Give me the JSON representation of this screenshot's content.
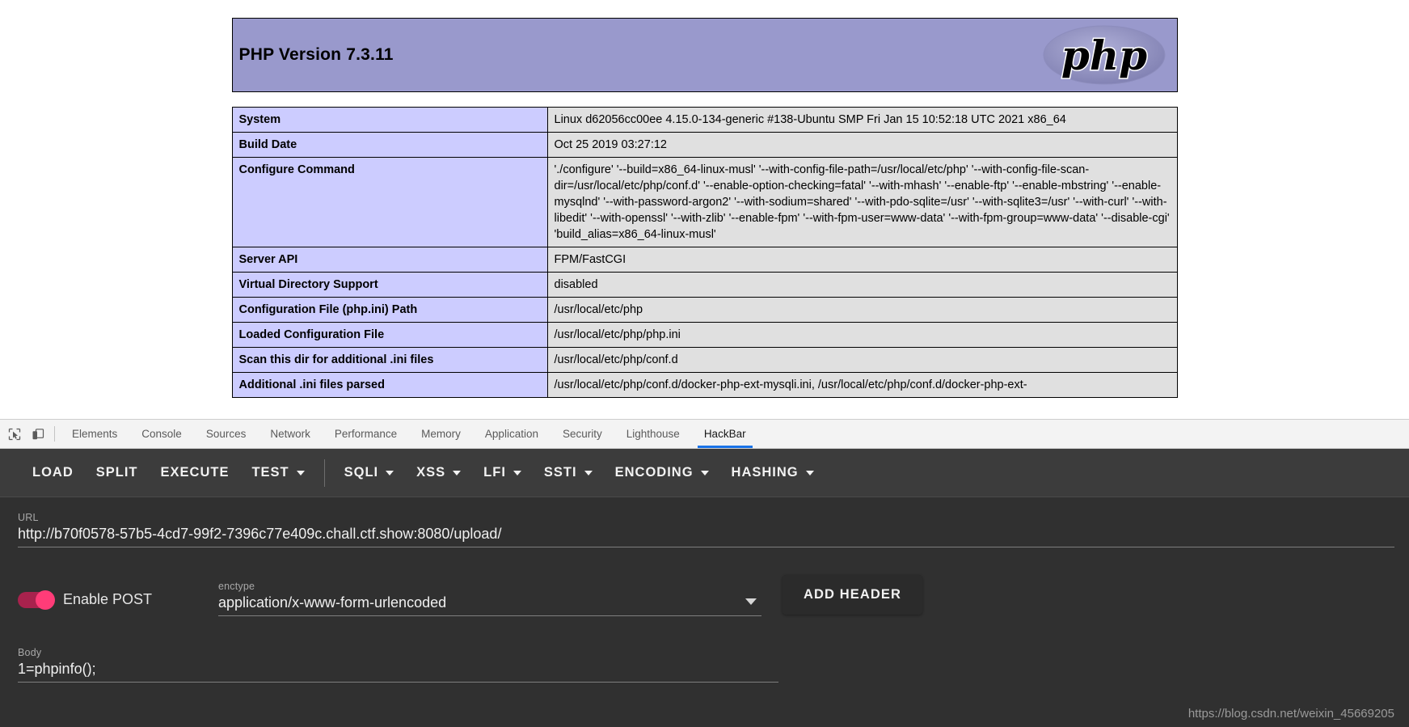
{
  "page": {
    "php_title": "PHP Version 7.3.11",
    "logo_text": "php",
    "table": [
      {
        "key": "System",
        "value": "Linux d62056cc00ee 4.15.0-134-generic #138-Ubuntu SMP Fri Jan 15 10:52:18 UTC 2021 x86_64"
      },
      {
        "key": "Build Date",
        "value": "Oct 25 2019 03:27:12"
      },
      {
        "key": "Configure Command",
        "value": "'./configure' '--build=x86_64-linux-musl' '--with-config-file-path=/usr/local/etc/php' '--with-config-file-scan-dir=/usr/local/etc/php/conf.d' '--enable-option-checking=fatal' '--with-mhash' '--enable-ftp' '--enable-mbstring' '--enable-mysqlnd' '--with-password-argon2' '--with-sodium=shared' '--with-pdo-sqlite=/usr' '--with-sqlite3=/usr' '--with-curl' '--with-libedit' '--with-openssl' '--with-zlib' '--enable-fpm' '--with-fpm-user=www-data' '--with-fpm-group=www-data' '--disable-cgi' 'build_alias=x86_64-linux-musl'"
      },
      {
        "key": "Server API",
        "value": "FPM/FastCGI"
      },
      {
        "key": "Virtual Directory Support",
        "value": "disabled"
      },
      {
        "key": "Configuration File (php.ini) Path",
        "value": "/usr/local/etc/php"
      },
      {
        "key": "Loaded Configuration File",
        "value": "/usr/local/etc/php/php.ini"
      },
      {
        "key": "Scan this dir for additional .ini files",
        "value": "/usr/local/etc/php/conf.d"
      },
      {
        "key": "Additional .ini files parsed",
        "value": "/usr/local/etc/php/conf.d/docker-php-ext-mysqli.ini, /usr/local/etc/php/conf.d/docker-php-ext-"
      }
    ]
  },
  "devtools": {
    "icons": [
      {
        "name": "inspect-element-icon"
      },
      {
        "name": "device-toolbar-icon"
      }
    ],
    "tabs": [
      {
        "label": "Elements",
        "active": false
      },
      {
        "label": "Console",
        "active": false
      },
      {
        "label": "Sources",
        "active": false
      },
      {
        "label": "Network",
        "active": false
      },
      {
        "label": "Performance",
        "active": false
      },
      {
        "label": "Memory",
        "active": false
      },
      {
        "label": "Application",
        "active": false
      },
      {
        "label": "Security",
        "active": false
      },
      {
        "label": "Lighthouse",
        "active": false
      },
      {
        "label": "HackBar",
        "active": true
      }
    ],
    "active_tab_underline_color": "#1a73e8"
  },
  "hackbar": {
    "toolbar": {
      "load": "LOAD",
      "split": "SPLIT",
      "execute": "EXECUTE",
      "test": "TEST",
      "sqli": "SQLI",
      "xss": "XSS",
      "lfi": "LFI",
      "ssti": "SSTI",
      "encoding": "ENCODING",
      "hashing": "HASHING"
    },
    "url": {
      "label": "URL",
      "value": "http://b70f0578-57b5-4cd7-99f2-7396c77e409c.chall.ctf.show:8080/upload/"
    },
    "post": {
      "toggle_label": "Enable POST",
      "toggle_on": true,
      "toggle_color": "#ff3c78"
    },
    "enctype": {
      "label": "enctype",
      "value": "application/x-www-form-urlencoded"
    },
    "add_header_label": "ADD HEADER",
    "body": {
      "label": "Body",
      "value": "1=phpinfo();"
    }
  },
  "watermark": "https://blog.csdn.net/weixin_45669205"
}
